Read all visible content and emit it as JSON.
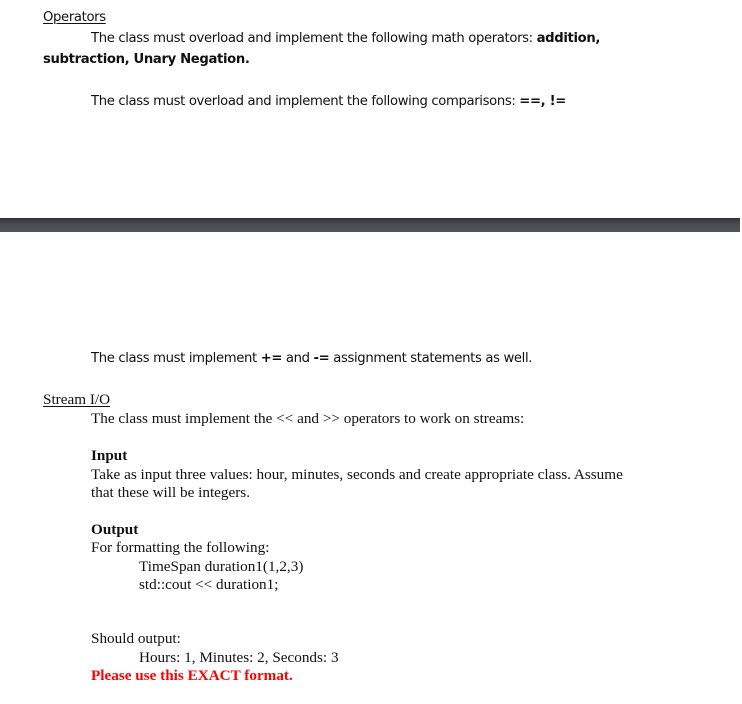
{
  "operators": {
    "heading": "Operators",
    "math_line1_prefix": "The class must overload and implement the following math operators:  ",
    "math_line1_bold": "addition,",
    "math_line2_bold": "subtraction, Unary Negation.",
    "comparisons_prefix": "The class must overload and implement the following comparisons:  ",
    "comparisons_bold": "==, !=",
    "assignment_prefix": "The class must implement ",
    "assignment_op1": "+=",
    "assignment_mid": " and ",
    "assignment_op2": "-=",
    "assignment_suffix": " assignment statements as well."
  },
  "stream_io": {
    "heading": "Stream I/O",
    "intro": "The class must implement the << and >> operators to work on streams:",
    "input": {
      "heading": "Input",
      "line1": "Take as input three values: hour, minutes, seconds and create appropriate class.  Assume",
      "line2": "that these will be integers."
    },
    "output": {
      "heading": "Output",
      "intro": "For formatting the following:",
      "code": [
        "TimeSpan duration1(1,2,3)",
        "std::cout << duration1;"
      ],
      "should_output_label": "Should output:",
      "expected": "Hours: 1, Minutes: 2, Seconds: 3",
      "warning": "Please use this EXACT format."
    }
  },
  "colors": {
    "warning": "#ff0000",
    "divider_band": "#4a4e52"
  }
}
